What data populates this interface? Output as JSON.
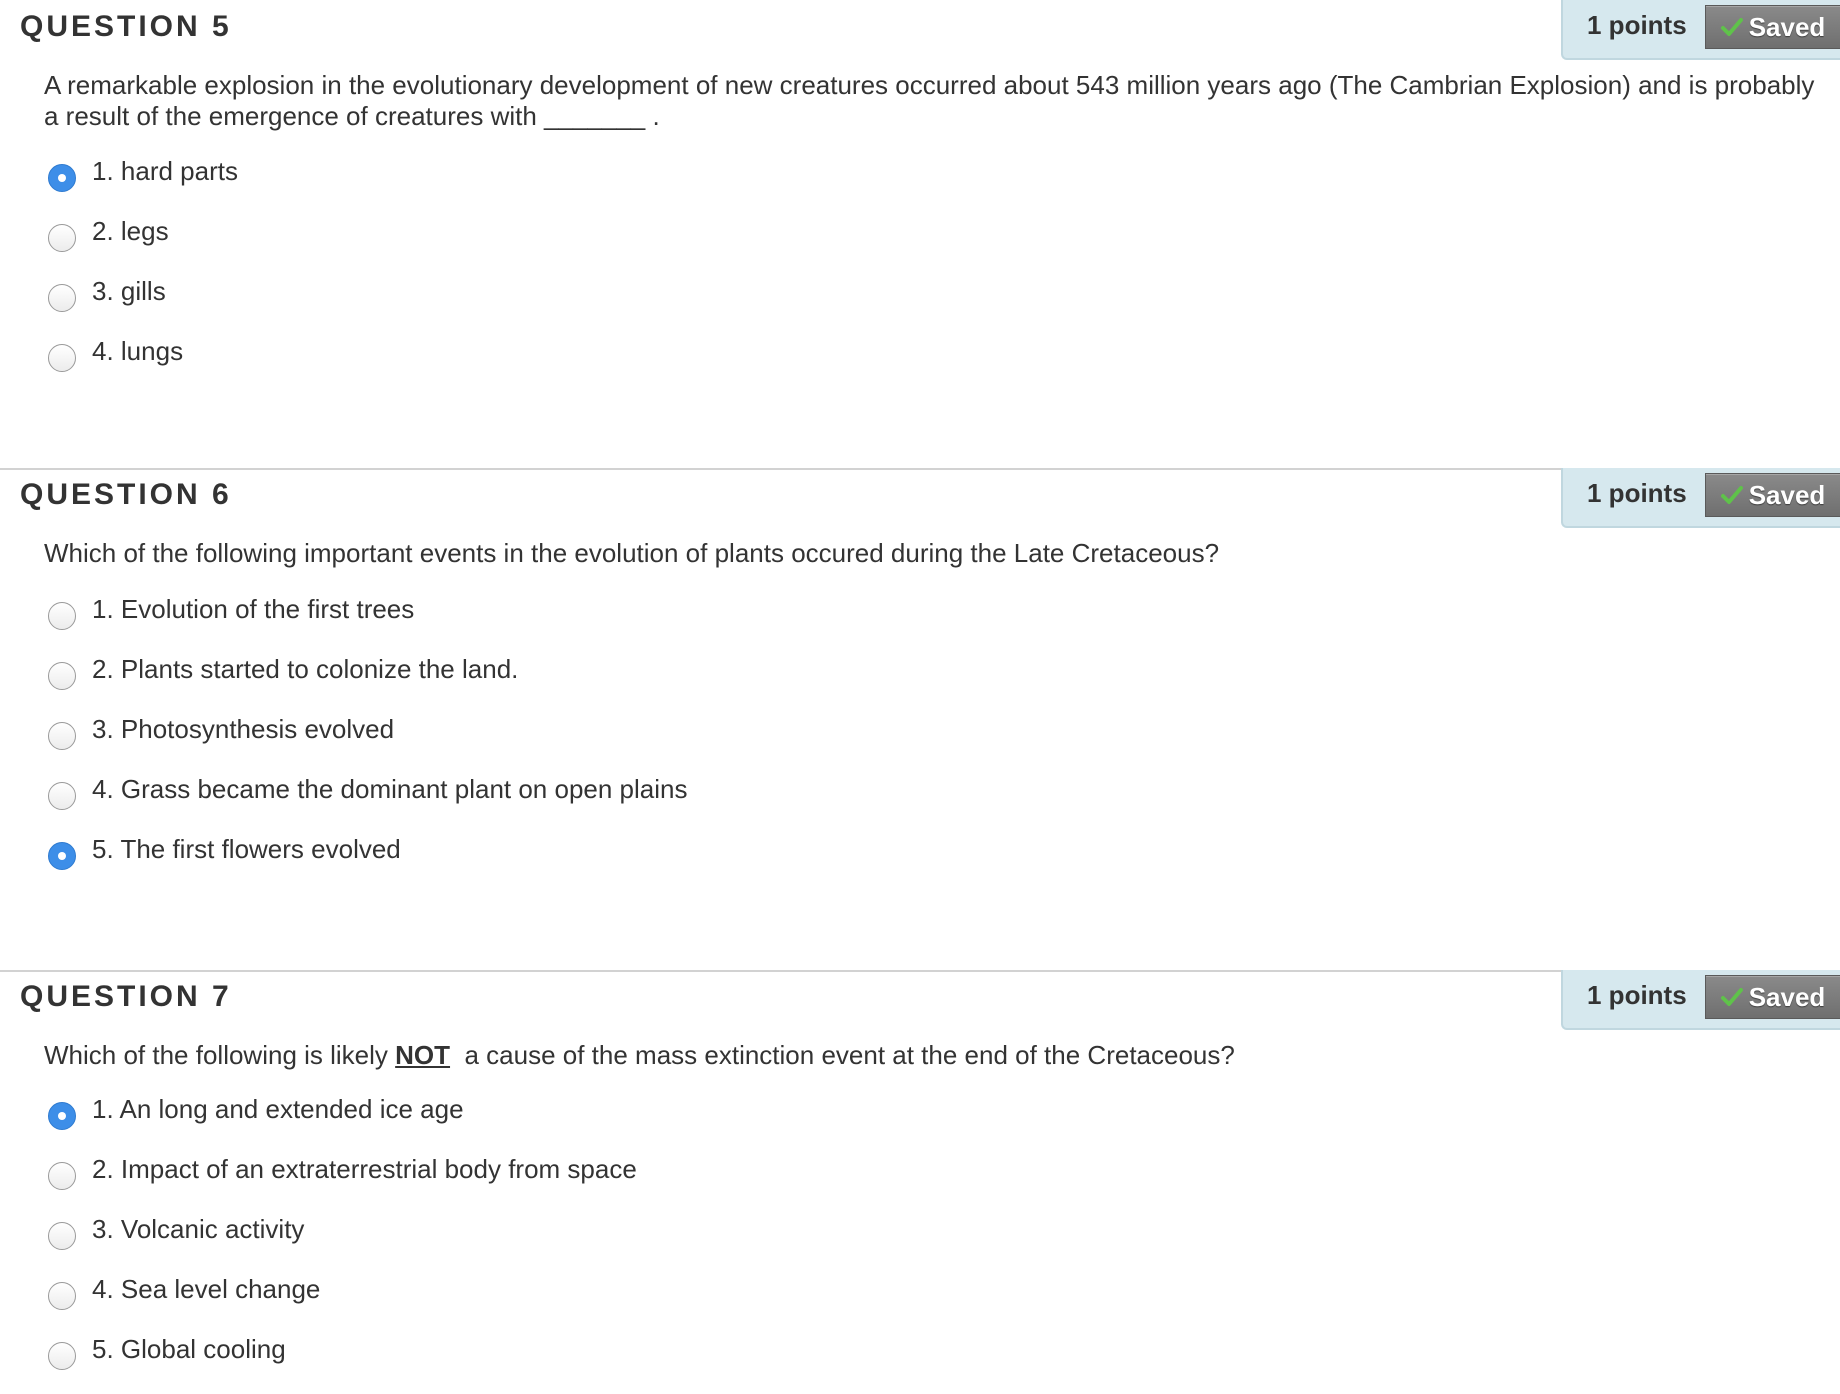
{
  "colors": {
    "points_box_bg": "#d6e8ee",
    "saved_button_bg": "#7c7c7c",
    "saved_check": "#5fc24a",
    "radio_selected": "#3d8ee8",
    "divider": "#d2d2d2",
    "text": "#333333"
  },
  "icons": {
    "saved": "checkmark-icon"
  },
  "questions": [
    {
      "title": "QUESTION 5",
      "points": "1 points",
      "saved_label": "Saved",
      "text": "A remarkable explosion in the evolutionary development of new creatures occurred about 543 million years ago (The Cambrian Explosion) and is probably a result of the emergence of creatures with _______ .",
      "options": [
        {
          "label": "1. hard parts",
          "selected": true
        },
        {
          "label": "2. legs",
          "selected": false
        },
        {
          "label": "3. gills",
          "selected": false
        },
        {
          "label": "4. lungs",
          "selected": false
        }
      ]
    },
    {
      "title": "QUESTION 6",
      "points": "1 points",
      "saved_label": "Saved",
      "text": "Which of the following important events in the evolution of plants occured during the Late Cretaceous?",
      "options": [
        {
          "label": "1. Evolution of the first trees",
          "selected": false
        },
        {
          "label": "2. Plants started to colonize the land.",
          "selected": false
        },
        {
          "label": "3. Photosynthesis evolved",
          "selected": false
        },
        {
          "label": "4. Grass became the dominant plant on open plains",
          "selected": false
        },
        {
          "label": "5. The first flowers evolved",
          "selected": true
        }
      ]
    },
    {
      "title": "QUESTION 7",
      "points": "1 points",
      "saved_label": "Saved",
      "text_before": "Which of the following is likely ",
      "text_emphasis": "NOT",
      "text_after": "  a cause of the mass extinction event at the end of the Cretaceous?",
      "options": [
        {
          "label": "1. An long and extended ice age",
          "selected": true
        },
        {
          "label": "2. Impact of an extraterrestrial body from space",
          "selected": false
        },
        {
          "label": "3. Volcanic activity",
          "selected": false
        },
        {
          "label": "4. Sea level change",
          "selected": false
        },
        {
          "label": "5. Global cooling",
          "selected": false
        }
      ]
    }
  ]
}
